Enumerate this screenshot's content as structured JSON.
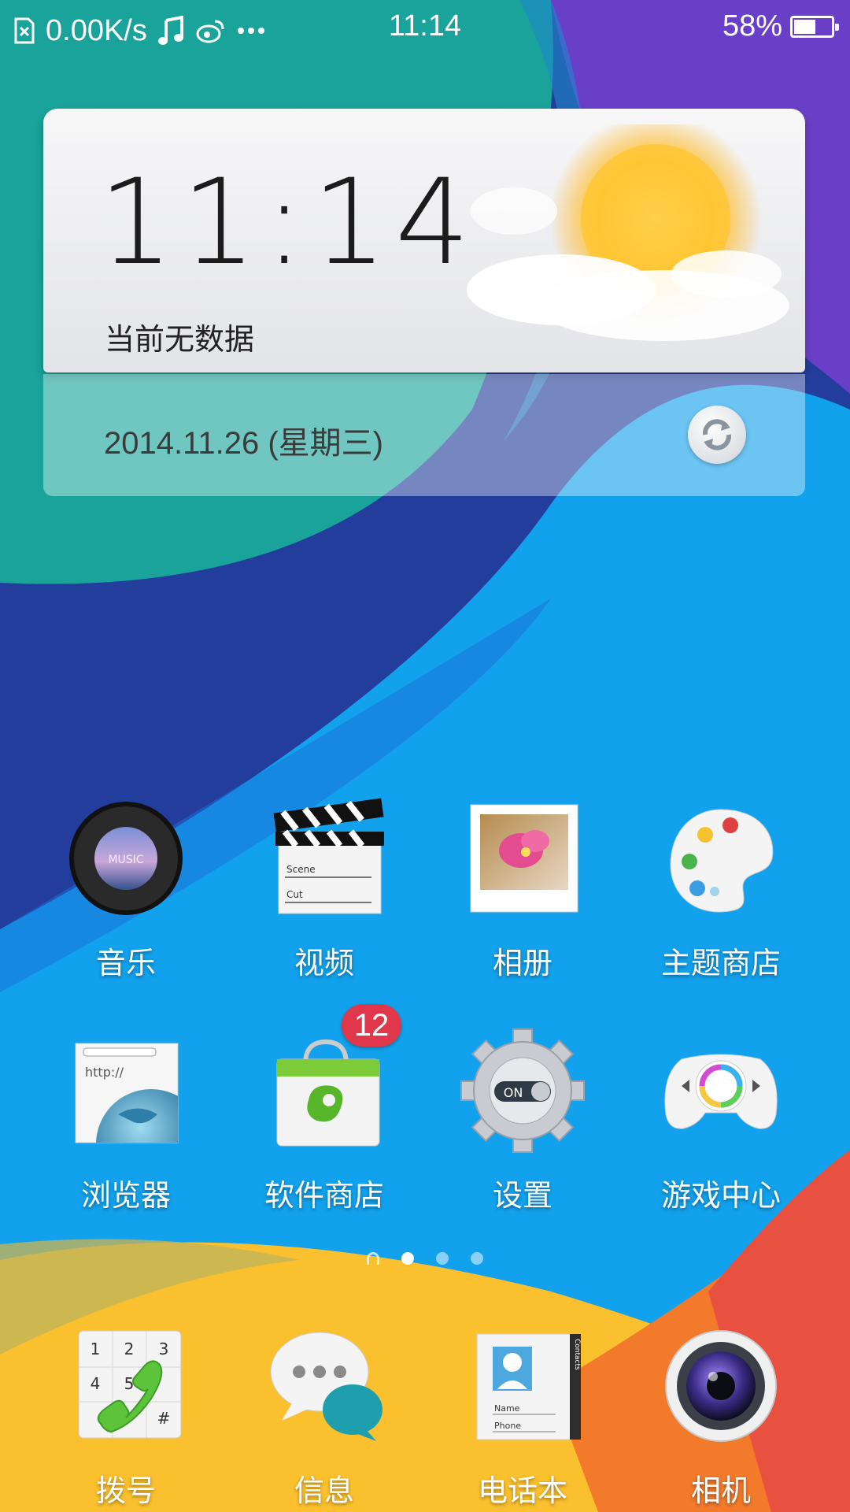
{
  "status_bar": {
    "speed": "0.00K/s",
    "time": "11:14",
    "battery": "58%",
    "battery_level": 0.58,
    "icons": [
      "sim-card-icon",
      "music-note-icon",
      "weibo-icon",
      "more-dots-icon"
    ]
  },
  "widget": {
    "clock": "11:14",
    "weather": "当前无数据",
    "date": "2014.11.26 (星期三)"
  },
  "apps": [
    {
      "label": "音乐",
      "icon": "music-icon"
    },
    {
      "label": "视频",
      "icon": "video-clapper-icon",
      "clapper_scene": "Scene",
      "clapper_cut": "Cut"
    },
    {
      "label": "相册",
      "icon": "gallery-photo-icon"
    },
    {
      "label": "主题商店",
      "icon": "theme-palette-icon"
    },
    {
      "label": "浏览器",
      "icon": "browser-globe-icon",
      "url_text": "http://"
    },
    {
      "label": "软件商店",
      "icon": "app-store-bag-icon",
      "badge": "12"
    },
    {
      "label": "设置",
      "icon": "settings-gear-icon",
      "toggle_text": "ON"
    },
    {
      "label": "游戏中心",
      "icon": "gamepad-icon"
    }
  ],
  "music_icon_text": "MUSIC",
  "dock": [
    {
      "label": "拨号",
      "icon": "dialer-icon",
      "keys": [
        "1",
        "2",
        "3",
        "4",
        "5",
        "#"
      ]
    },
    {
      "label": "信息",
      "icon": "messages-icon"
    },
    {
      "label": "电话本",
      "icon": "contacts-book-icon",
      "tab": "Contacts",
      "field_name": "Name",
      "field_phone": "Phone"
    },
    {
      "label": "相机",
      "icon": "camera-lens-icon"
    }
  ],
  "pager": {
    "pages": 3,
    "current": 0
  },
  "colors": {
    "teal": "#19a39a",
    "blue": "#14a3ee",
    "navy": "#233d9c",
    "purple": "#6a3fc8",
    "yellow": "#fbc02d",
    "orange": "#f37a2a",
    "red": "#e8503f",
    "badge": "#e0384a"
  }
}
